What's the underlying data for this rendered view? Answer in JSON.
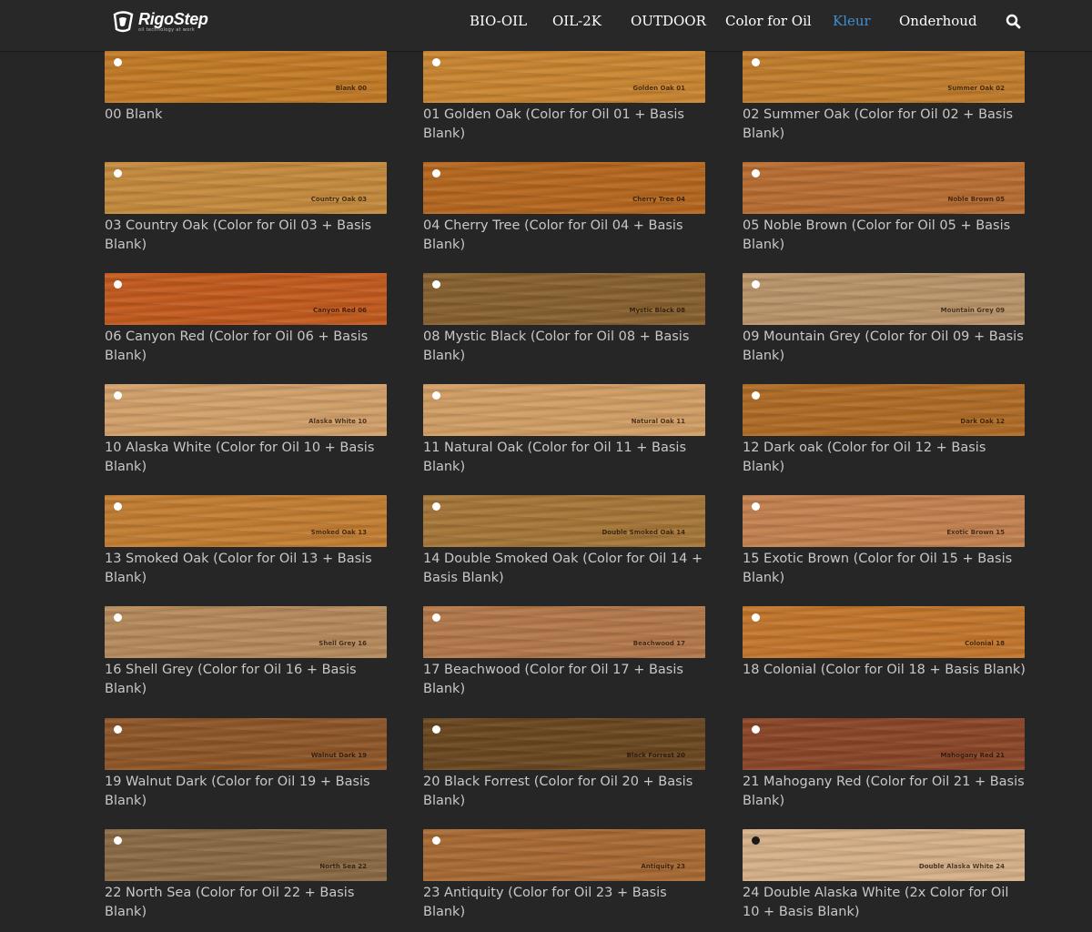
{
  "header": {
    "logo_name": "RigoStep",
    "logo_tagline": "oil technology at work",
    "nav": [
      {
        "label": "BIO-OIL",
        "active": false
      },
      {
        "label": "OIL-2K",
        "active": false
      },
      {
        "label": "OUTDOOR",
        "active": false
      },
      {
        "label": "Color for Oil",
        "active": false
      },
      {
        "label": "Kleur",
        "active": true
      },
      {
        "label": "Onderhoud",
        "active": false
      }
    ],
    "search_icon": "search-icon",
    "active_color": "#3f8fd0"
  },
  "swatches": [
    {
      "tag": "Blank 00",
      "label": "00 Blank",
      "color": "#c27a26"
    },
    {
      "tag": "Golden Oak 01",
      "label": "01 Golden Oak (Color for Oil 01 + Basis Blank)",
      "color": "#c98531"
    },
    {
      "tag": "Summer Oak 02",
      "label": "02 Summer Oak (Color for Oil 02 + Basis Blank)",
      "color": "#c17d2c"
    },
    {
      "tag": "Country Oak 03",
      "label": "03 Country Oak (Color for Oil 03 + Basis Blank)",
      "color": "#c48a3d"
    },
    {
      "tag": "Cherry Tree 04",
      "label": "04 Cherry Tree (Color for Oil 04 + Basis Blank)",
      "color": "#b5671f"
    },
    {
      "tag": "Noble Brown 05",
      "label": "05 Noble Brown (Color for Oil 05 + Basis Blank)",
      "color": "#b86d32"
    },
    {
      "tag": "Canyon Red 06",
      "label": "06 Canyon Red (Color for Oil 06 + Basis Blank)",
      "color": "#c25a1e"
    },
    {
      "tag": "Mystic Black 08",
      "label": "08 Mystic Black (Color for Oil 08 + Basis Blank)",
      "color": "#87602f"
    },
    {
      "tag": "Mountain Grey 09",
      "label": "09 Mountain Grey (Color for Oil 09 + Basis Blank)",
      "color": "#b9946a"
    },
    {
      "tag": "Alaska White 10",
      "label": "10 Alaska White (Color for Oil 10 + Basis Blank)",
      "color": "#d2a06a"
    },
    {
      "tag": "Natural Oak 11",
      "label": "11 Natural Oak (Color for Oil 11 + Basis Blank)",
      "color": "#d19e65"
    },
    {
      "tag": "Dark Oak 12",
      "label": "12 Dark oak (Color for Oil 12 + Basis Blank)",
      "color": "#af6b26"
    },
    {
      "tag": "Smoked Oak 13",
      "label": "13 Smoked Oak (Color for Oil 13 + Basis Blank)",
      "color": "#c27d32"
    },
    {
      "tag": "Double Smoked Oak 14",
      "label": "14 Double Smoked Oak (Color for Oil 14 + Basis Blank)",
      "color": "#a57638"
    },
    {
      "tag": "Exotic Brown 15",
      "label": "15 Exotic Brown (Color for Oil 15 + Basis Blank)",
      "color": "#c38150"
    },
    {
      "tag": "Shell Grey 16",
      "label": "16 Shell Grey (Color for Oil 16 + Basis Blank)",
      "color": "#b58a5c"
    },
    {
      "tag": "Beachwood 17",
      "label": "17 Beachwood (Color for Oil 17 + Basis Blank)",
      "color": "#b3784a"
    },
    {
      "tag": "Colonial 18",
      "label": "18 Colonial (Color for Oil 18 + Basis Blank)",
      "color": "#c2762c"
    },
    {
      "tag": "Walnut Dark 19",
      "label": "19 Walnut Dark (Color for Oil 19 + Basis Blank)",
      "color": "#8e5628"
    },
    {
      "tag": "Black Forrest 20",
      "label": "20 Black Forrest (Color for Oil 20 + Basis Blank)",
      "color": "#6a4720"
    },
    {
      "tag": "Mahogany Red 21",
      "label": "21 Mahogany Red (Color for Oil 21 + Basis Blank)",
      "color": "#8a4628"
    },
    {
      "tag": "North Sea 22",
      "label": "22 North Sea (Color for Oil 22 + Basis Blank)",
      "color": "#8a6a44"
    },
    {
      "tag": "Antiquity 23",
      "label": "23 Antiquity (Color for Oil 23 + Basis Blank)",
      "color": "#a86a34"
    },
    {
      "tag": "Double Alaska White 24",
      "label": "24 Double Alaska White (2x Color for Oil 10 + Basis Blank)",
      "color": "#d6b089",
      "dark_dot": true
    }
  ]
}
